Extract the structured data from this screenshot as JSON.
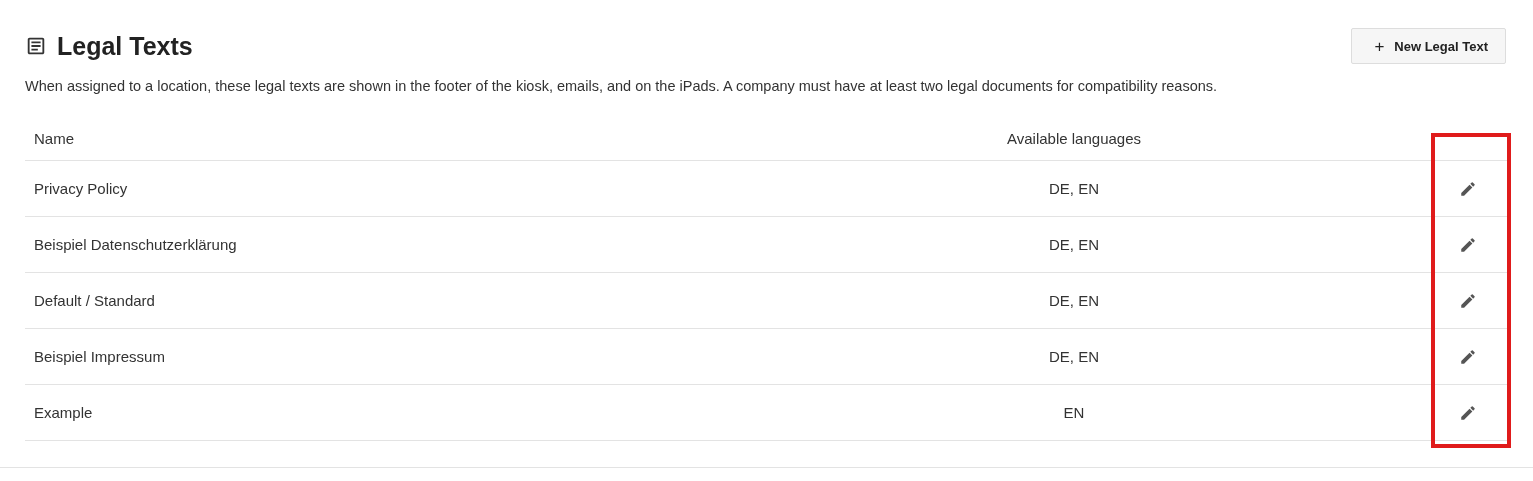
{
  "header": {
    "title": "Legal Texts",
    "new_button": {
      "icon": "+",
      "label": "New Legal Text"
    }
  },
  "description": "When assigned to a location, these legal texts are shown in the footer of the kiosk, emails, and on the iPads. A company must have at least two legal documents for compatibility reasons.",
  "table": {
    "columns": [
      "Name",
      "Available languages"
    ],
    "edit_column_highlighted": true,
    "rows": [
      {
        "name": "Privacy Policy",
        "languages": "DE, EN"
      },
      {
        "name": "Beispiel Datenschutzerklärung",
        "languages": "DE, EN"
      },
      {
        "name": "Default / Standard",
        "languages": "DE, EN"
      },
      {
        "name": "Beispiel Impressum",
        "languages": "DE, EN"
      },
      {
        "name": "Example",
        "languages": "EN"
      }
    ]
  }
}
